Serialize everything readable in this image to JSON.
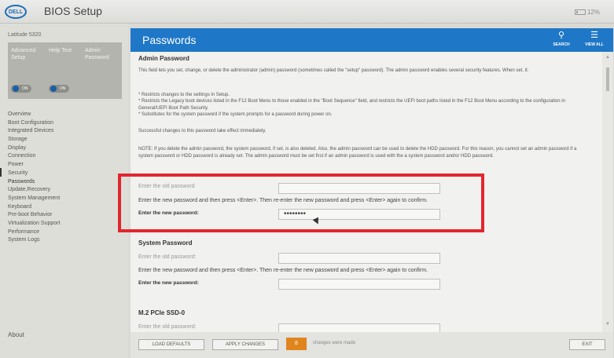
{
  "app": {
    "logo": "DELL",
    "title": "BIOS Setup",
    "battery": "12%"
  },
  "sidebar": {
    "model": "Latitude 5320",
    "toggles": [
      {
        "label": "Advanced Setup",
        "state": "ON"
      },
      {
        "label": "Help Text",
        "state": "ON"
      },
      {
        "label": "Admin Password",
        "state": ""
      }
    ],
    "items": [
      {
        "label": "Overview"
      },
      {
        "label": "Boot Configuration"
      },
      {
        "label": "Integrated Devices"
      },
      {
        "label": "Storage"
      },
      {
        "label": "Display"
      },
      {
        "label": "Connection"
      },
      {
        "label": "Power"
      },
      {
        "label": "Security"
      },
      {
        "label": "Passwords"
      },
      {
        "label": "Update,Recovery"
      },
      {
        "label": "System Management"
      },
      {
        "label": "Keyboard"
      },
      {
        "label": "Pre-boot Behavior"
      },
      {
        "label": "Virtualization Support"
      },
      {
        "label": "Performance"
      },
      {
        "label": "System Logs"
      }
    ],
    "active_item": "Passwords",
    "about": "About"
  },
  "header": {
    "title": "Passwords",
    "search_label": "SEARCH",
    "view_all_label": "VIEW ALL"
  },
  "admin": {
    "title": "Admin Password",
    "description": "This field lets you set, change, or delete the administrator (admin) password (sometimes called the \"setup\" password). The admin password enables several security features. When set, it:",
    "bullets": [
      "* Restricts changes to the settings in Setup.",
      "* Restricts the Legacy boot devices listed in the F12 Boot Menu to those enabled in the \"Boot Sequence\" field, and restricts the UEFI boot paths listed in the F12 Boot Menu according to the configuration in General/UEFI Boot Path Security.",
      "* Substitutes for the system password if the system prompts for a password during power on."
    ],
    "effect_note": "Successful changes to this password take effect immediately.",
    "note": "NOTE: If you delete the admin password, the system password, if set, is also deleted. Also, the admin password can be used to delete the HDD password. For this reason, you cannot set an admin password if a system password or HDD password is already set. The admin password must be set first if an admin password is used with the a system password and/or HDD password.",
    "old_label": "Enter the old password",
    "instruction": "Enter the new password and then press <Enter>. Then re-enter the new password and press <Enter> again to confirm.",
    "new_label": "Enter the new password:",
    "new_value": "••••••••"
  },
  "system": {
    "title": "System Password",
    "old_label": "Enter the old password:",
    "instruction": "Enter the new password and then press <Enter>. Then re-enter the new password and press <Enter> again to confirm.",
    "new_label": "Enter the new password:"
  },
  "m2": {
    "title": "M.2 PCIe SSD-0",
    "old_label": "Enter the old password:"
  },
  "footer": {
    "load_defaults": "LOAD DEFAULTS",
    "apply_changes": "APPLY CHANGES",
    "changes_count": "8",
    "changes_text": "changes were made",
    "exit": "EXIT"
  },
  "colors": {
    "header_blue": "#1f77c7",
    "highlight_red": "#e3262e",
    "changes_orange": "#e0851e"
  }
}
